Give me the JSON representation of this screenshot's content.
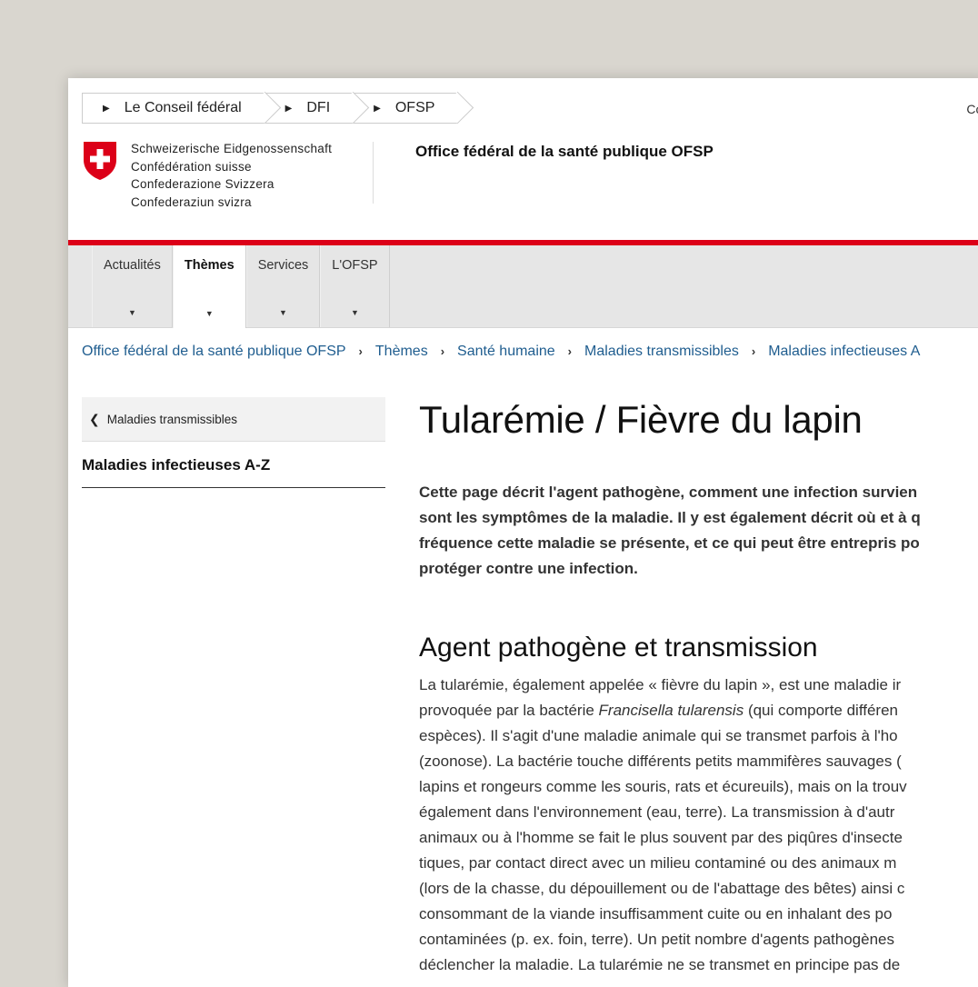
{
  "topbar": {
    "items": [
      "Le Conseil fédéral",
      "DFI",
      "OFSP"
    ],
    "right_text": "Cont"
  },
  "brand": {
    "lines": [
      "Schweizerische Eidgenossenschaft",
      "Confédération suisse",
      "Confederazione Svizzera",
      "Confederaziun svizra"
    ],
    "office_title": "Office fédéral de la santé publique OFSP"
  },
  "nav": {
    "items": [
      {
        "label": "Actualités"
      },
      {
        "label": "Thèmes"
      },
      {
        "label": "Services"
      },
      {
        "label": "L'OFSP"
      }
    ],
    "caret": "▼"
  },
  "breadcrumb": {
    "items": [
      "Office fédéral de la santé publique OFSP",
      "Thèmes",
      "Santé humaine",
      "Maladies transmissibles",
      "Maladies infectieuses A"
    ],
    "separator": "›"
  },
  "sidebar": {
    "back_label": "Maladies transmissibles",
    "current": "Maladies infectieuses A-Z"
  },
  "main": {
    "title": "Tularémie / Fièvre du lapin",
    "lead_lines": [
      "Cette page décrit l'agent pathogène, comment une infection survien",
      "sont les symptômes de la maladie. Il y est également décrit où et à q",
      "fréquence cette maladie se présente, et ce qui peut être entrepris po",
      "protéger contre une infection."
    ],
    "section_title": "Agent pathogène et transmission",
    "body": {
      "line1": "La tularémie, également appelée « fièvre du lapin », est une maladie ir",
      "line2_pre": "provoquée par la bactérie ",
      "line2_em": "Francisella tularensis",
      "line2_post": " (qui comporte différen",
      "line3": "espèces). Il s'agit d'une maladie animale qui se transmet parfois à l'ho",
      "line4": "(zoonose). La bactérie touche différents petits mammifères sauvages (",
      "line5": "lapins et rongeurs comme les souris, rats et écureuils), mais on la trouv",
      "line6": "également dans l'environnement (eau, terre). La transmission à d'autr",
      "line7": "animaux ou à l'homme se fait le plus souvent par des piqûres d'insecte",
      "line8": "tiques, par contact direct avec un milieu contaminé ou des animaux m",
      "line9": "(lors de la chasse, du dépouillement ou de l'abattage des bêtes) ainsi c",
      "line10": "consommant de la viande insuffisamment cuite ou en inhalant des po",
      "line11": "contaminées (p. ex. foin, terre). Un petit nombre d'agents pathogènes",
      "line12": "déclencher la maladie. La tularémie ne se transmet en principe pas de"
    }
  },
  "colors": {
    "accent_red": "#dc0018",
    "link_blue": "#1f5d8f",
    "nav_bg": "#e6e6e6"
  }
}
